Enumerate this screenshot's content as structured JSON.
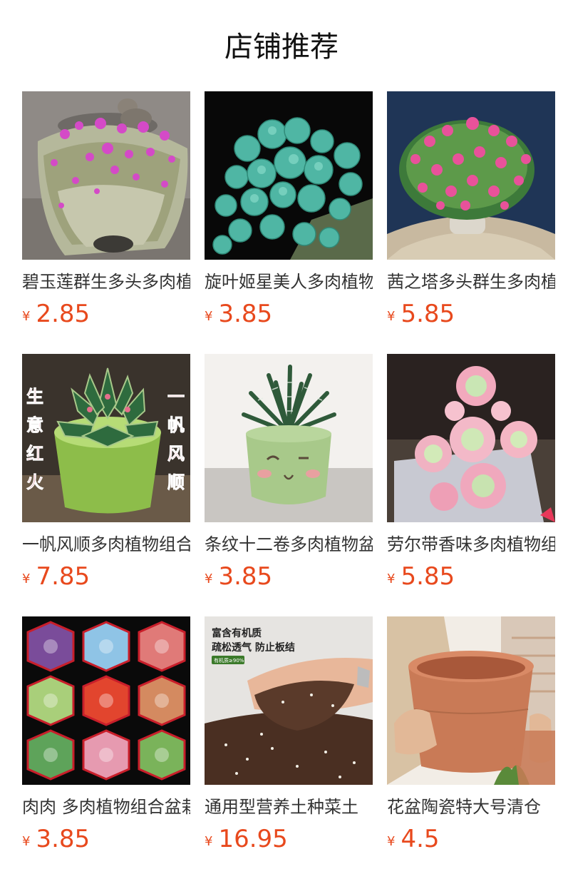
{
  "header": {
    "title": "店铺推荐"
  },
  "currency_symbol": "¥",
  "products": [
    {
      "name": "碧玉莲群生多头多肉植物",
      "price": "2.85",
      "image": "hanging-succulent-pink-flowers"
    },
    {
      "name": "旋叶姬星美人多肉植物",
      "price": "3.85",
      "image": "teal-succulent-cluster"
    },
    {
      "name": "茜之塔多头群生多肉植物",
      "price": "5.85",
      "image": "pink-flowering-succulent"
    },
    {
      "name": "一帆风顺多肉植物组合",
      "price": "7.85",
      "image": "red-fire-succulent-green-pot",
      "banner_left": "生意红火",
      "banner_right": "一帆风顺"
    },
    {
      "name": "条纹十二卷多肉植物盆栽",
      "price": "3.85",
      "image": "zebra-haworthia-smiley-pot"
    },
    {
      "name": "劳尔带香味多肉植物组合",
      "price": "5.85",
      "image": "pastel-rosette-succulent"
    },
    {
      "name": "肉肉 多肉植物组合盆栽",
      "price": "3.85",
      "image": "succulent-hexagon-collage"
    },
    {
      "name": "通用型营养土种菜土",
      "price": "16.95",
      "image": "hands-holding-soil",
      "caption_line1": "富含有机质",
      "caption_line2": "疏松透气 防止板结",
      "badge": "有机质≥90%"
    },
    {
      "name": "花盆陶瓷特大号清仓",
      "price": "4.5",
      "image": "terracotta-pot"
    }
  ]
}
